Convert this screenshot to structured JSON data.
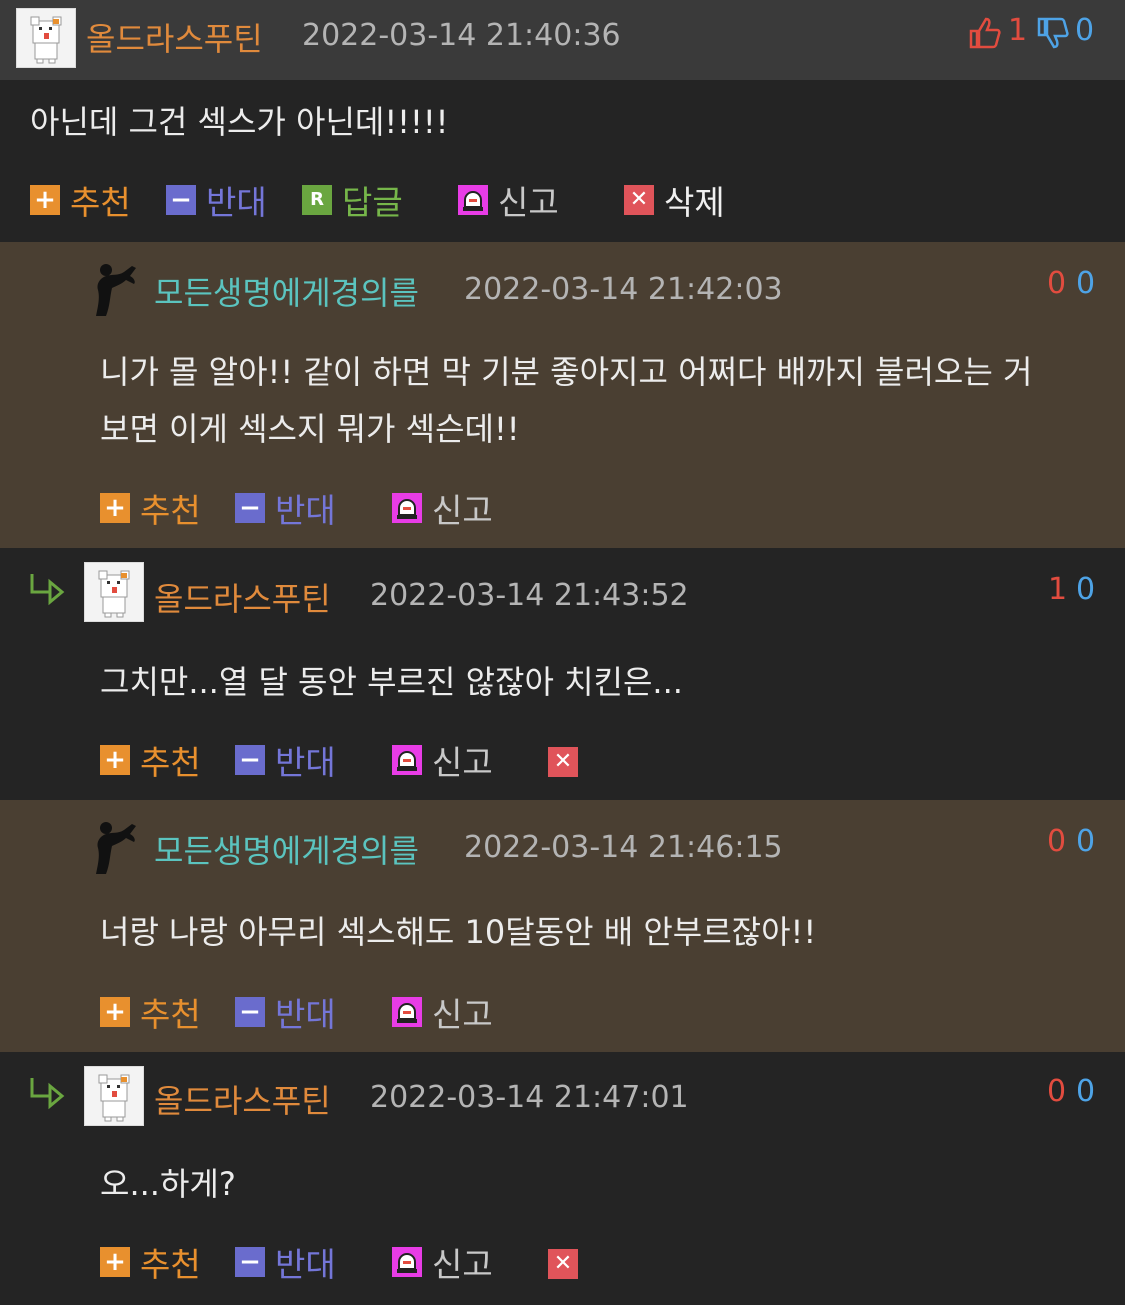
{
  "comments": [
    {
      "nick": "올드라스푸틴",
      "date": "2022-03-14 21:40:36",
      "up": "1",
      "down": "0",
      "text": [
        "아닌데 그건 섹스가 아닌데!!!!!"
      ],
      "actions": {
        "recommend": "추천",
        "oppose": "반대",
        "reply": "답글",
        "report": "신고",
        "delete": "삭제"
      }
    },
    {
      "nick": "모든생명에게경의를",
      "date": "2022-03-14 21:42:03",
      "up": "0",
      "down": "0",
      "text": [
        "니가 몰 알아!! 같이 하면 막 기분 좋아지고 어쩌다 배까지 불러오는 거",
        "보면 이게 섹스지 뭐가 섹슨데!!"
      ],
      "actions": {
        "recommend": "추천",
        "oppose": "반대",
        "report": "신고"
      }
    },
    {
      "nick": "올드라스푸틴",
      "date": "2022-03-14 21:43:52",
      "up": "1",
      "down": "0",
      "text": [
        "그치만...열 달 동안 부르진 않잖아 치킨은..."
      ],
      "actions": {
        "recommend": "추천",
        "oppose": "반대",
        "report": "신고"
      }
    },
    {
      "nick": "모든생명에게경의를",
      "date": "2022-03-14 21:46:15",
      "up": "0",
      "down": "0",
      "text": [
        "너랑 나랑 아무리 섹스해도 10달동안 배 안부르잖아!!"
      ],
      "actions": {
        "recommend": "추천",
        "oppose": "반대",
        "report": "신고"
      }
    },
    {
      "nick": "올드라스푸틴",
      "date": "2022-03-14 21:47:01",
      "up": "0",
      "down": "0",
      "text": [
        "오...하게?"
      ],
      "actions": {
        "recommend": "추천",
        "oppose": "반대",
        "report": "신고"
      }
    }
  ],
  "colors": {
    "background": "#242424",
    "header": "#3a3a3a",
    "reply_bg": "#4a3f32",
    "nick_orange": "#e08a3c",
    "nick_cyan": "#5bc4bf",
    "vote_up": "#e24c3f",
    "vote_down": "#4ea3e6"
  }
}
